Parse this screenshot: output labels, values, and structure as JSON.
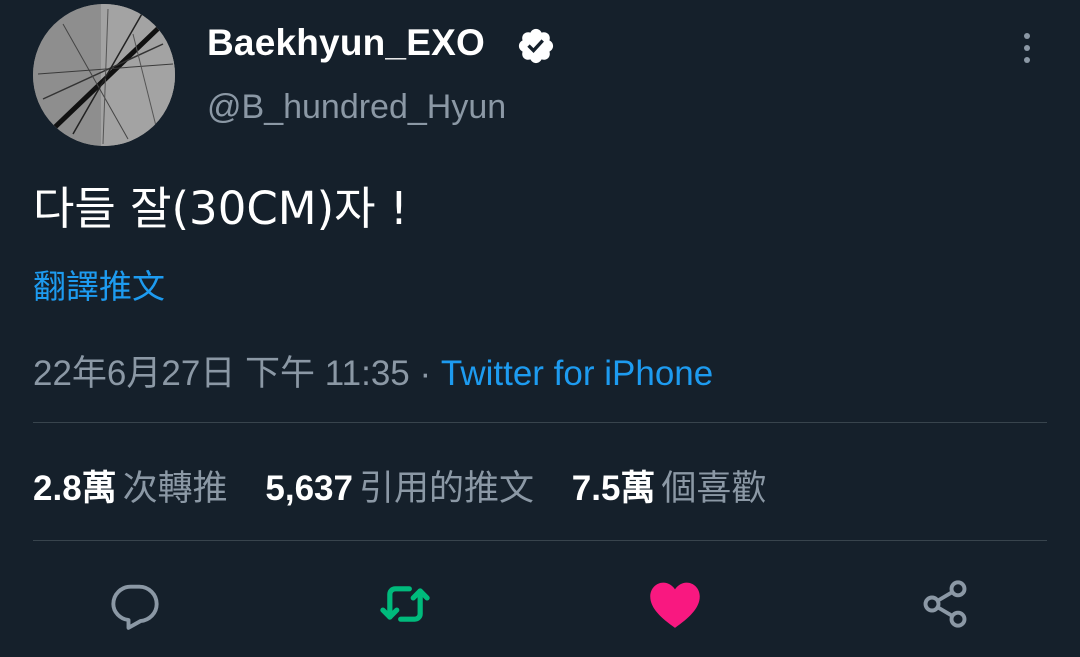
{
  "author": {
    "display_name": "Baekhyun_EXO",
    "handle": "@B_hundred_Hyun",
    "verified": true
  },
  "tweet": {
    "text": "다들 잘(30CM)자 !",
    "translate_label": "翻譯推文",
    "timestamp": "22年6月27日 下午 11:35",
    "separator": "·",
    "source": "Twitter for iPhone"
  },
  "stats": {
    "retweets": {
      "value": "2.8萬",
      "label": "次轉推"
    },
    "quotes": {
      "value": "5,637",
      "label": "引用的推文"
    },
    "likes": {
      "value": "7.5萬",
      "label": "個喜歡"
    }
  },
  "actions": {
    "icons": [
      "reply-icon",
      "retweet-icon",
      "like-icon",
      "share-icon"
    ],
    "retweet_color": "#00ba7c",
    "like_color": "#f91880",
    "default_color": "#8b98a5"
  },
  "colors": {
    "background": "#15202b",
    "link": "#1d9bf0",
    "secondary_text": "#8b98a5"
  }
}
